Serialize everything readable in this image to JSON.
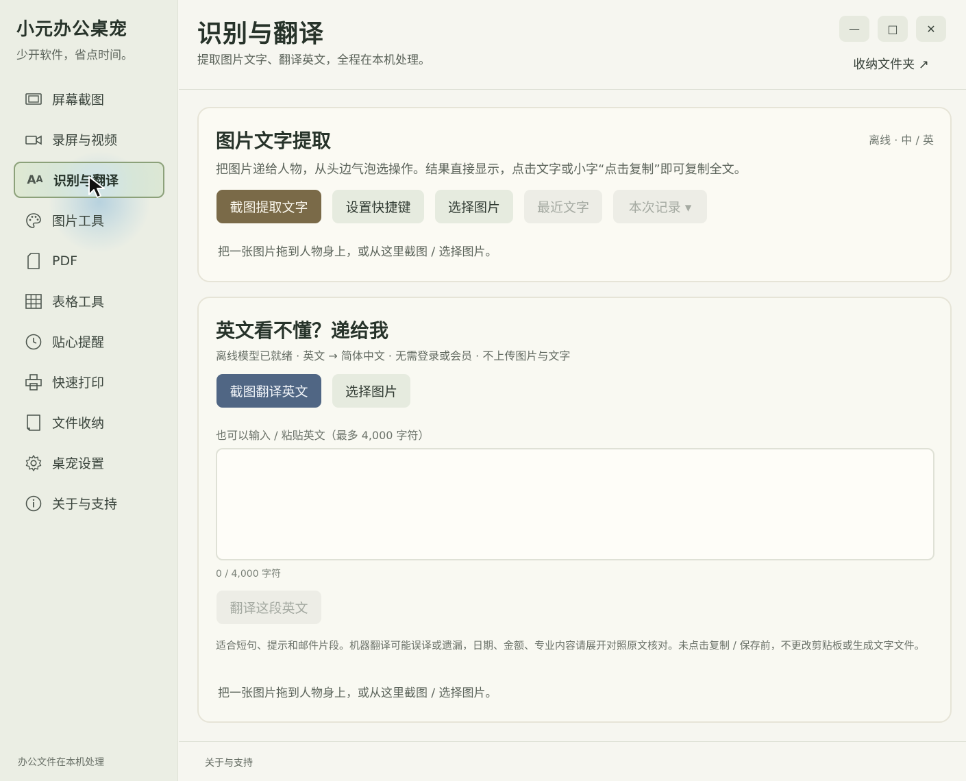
{
  "app": {
    "brand_title": "小元办公桌宠",
    "brand_subtitle": "少开软件，省点时间。",
    "footer_note": "办公文件在本机处理"
  },
  "sidebar": {
    "items": [
      {
        "label": "屏幕截图",
        "icon": "screenshot-icon"
      },
      {
        "label": "录屏与视频",
        "icon": "video-camera-icon"
      },
      {
        "label": "识别与翻译",
        "icon": "translate-icon",
        "active": true
      },
      {
        "label": "图片工具",
        "icon": "palette-icon"
      },
      {
        "label": "PDF",
        "icon": "document-icon"
      },
      {
        "label": "表格工具",
        "icon": "table-icon"
      },
      {
        "label": "贴心提醒",
        "icon": "clock-icon"
      },
      {
        "label": "快速打印",
        "icon": "printer-icon"
      },
      {
        "label": "文件收纳",
        "icon": "folder-icon"
      },
      {
        "label": "桌宠设置",
        "icon": "gear-icon"
      },
      {
        "label": "关于与支持",
        "icon": "info-icon"
      }
    ]
  },
  "header": {
    "title": "识别与翻译",
    "subtitle": "提取图片文字、翻译英文，全程在本机处理。",
    "folder_link": "收纳文件夹 ↗",
    "window_controls": {
      "minimize": "—",
      "maximize": "□",
      "close": "✕"
    }
  },
  "ocr_card": {
    "title": "图片文字提取",
    "tag": "离线 · 中 / 英",
    "description": "把图片递给人物，从头边气泡选操作。结果直接显示，点击文字或小字“点击复制”即可复制全文。",
    "buttons": {
      "capture": "截图提取文字",
      "shortcut": "设置快捷键",
      "choose_image": "选择图片",
      "recent_text": "最近文字",
      "session_history": "本次记录 ▾"
    },
    "hint": "把一张图片拖到人物身上，或从这里截图 / 选择图片。"
  },
  "translate_card": {
    "title": "英文看不懂？递给我",
    "status": "离线模型已就绪 · 英文 → 简体中文 · 无需登录或会员 · 不上传图片与文字",
    "buttons": {
      "capture_translate": "截图翻译英文",
      "choose_image": "选择图片",
      "translate_text": "翻译这段英文"
    },
    "input_label": "也可以输入 / 粘贴英文（最多 4,000 字符）",
    "input_value": "",
    "counter": "0 / 4,000 字符",
    "note": "适合短句、提示和邮件片段。机器翻译可能误译或遗漏，日期、金额、专业内容请展开对照原文核对。未点击复制 / 保存前，不更改剪贴板或生成文字文件。",
    "hint": "把一张图片拖到人物身上，或从这里截图 / 选择图片。"
  },
  "footer": {
    "link": "关于与支持"
  }
}
